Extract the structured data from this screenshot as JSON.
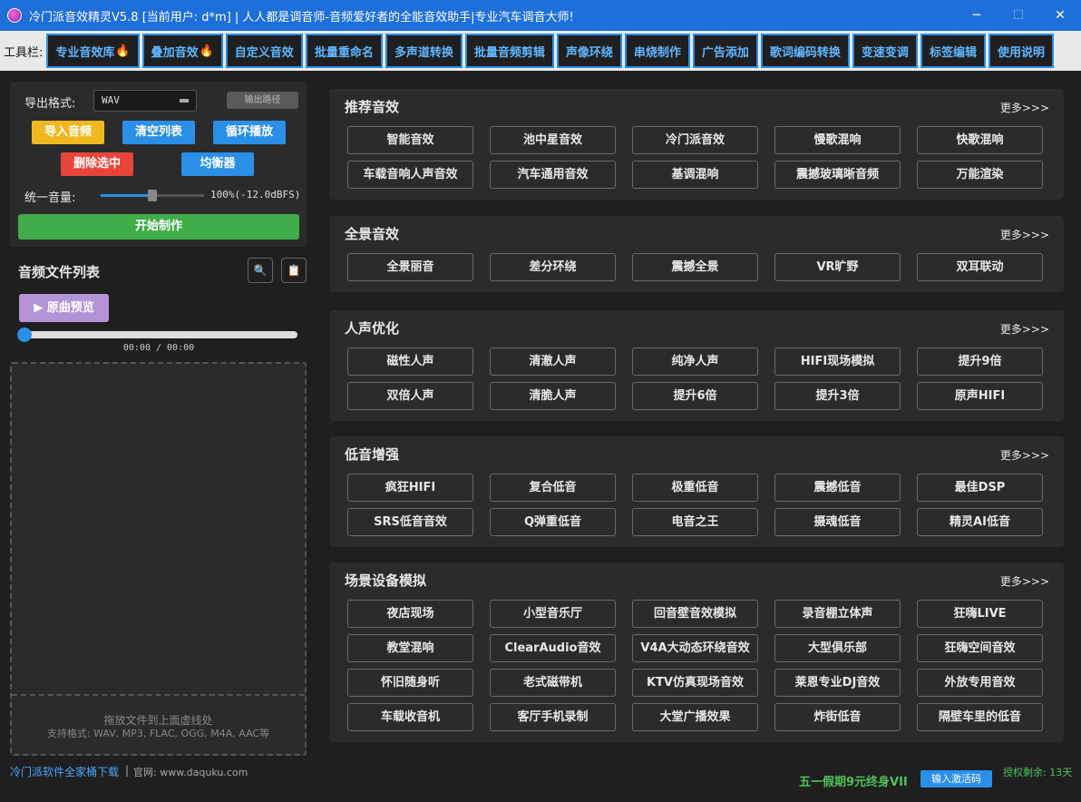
{
  "window": {
    "title": "冷门派音效精灵V5.8 [当前用户: d*m] | 人人都是调音师-音频爱好者的全能音效助手|专业汽车调音大师!",
    "minimize": "─",
    "maximize": "☐",
    "close": "✕"
  },
  "toolbar": {
    "label": "工具栏:",
    "items": [
      {
        "label": "专业音效库",
        "hot": true
      },
      {
        "label": "叠加音效",
        "hot": true
      },
      {
        "label": "自定义音效",
        "hot": false
      },
      {
        "label": "批量重命名",
        "hot": false
      },
      {
        "label": "多声道转换",
        "hot": false
      },
      {
        "label": "批量音频剪辑",
        "hot": false
      },
      {
        "label": "声像环绕",
        "hot": false
      },
      {
        "label": "串烧制作",
        "hot": false
      },
      {
        "label": "广告添加",
        "hot": false
      },
      {
        "label": "歌词编码转换",
        "hot": false
      },
      {
        "label": "变速变调",
        "hot": false
      },
      {
        "label": "标签编辑",
        "hot": false
      },
      {
        "label": "使用说明",
        "hot": false
      }
    ],
    "hot_glyph": "🔥"
  },
  "export": {
    "label": "导出格式:",
    "format": "WAV",
    "output_path": "输出路径",
    "import": "导入音频",
    "clear": "清空列表",
    "loop": "循环播放",
    "delete": "删除选中",
    "eq": "均衡器",
    "volume_label": "统一音量:",
    "volume_text": "100%(-12.0dBFS)",
    "volume_fraction": 0.5,
    "start": "开始制作"
  },
  "filelist": {
    "title": "音频文件列表",
    "search_glyph": "🔍",
    "clip_glyph": "📋",
    "preview": "▶ 原曲预览",
    "time": "00:00 / 00:00",
    "drop_hint": "拖放文件到上面虚线处",
    "formats": "支持格式: WAV, MP3, FLAC, OGG, M4A, AAC等"
  },
  "footer": {
    "link": "冷门派软件全家桶下载",
    "sep": "|",
    "site": "官网: www.daquku.com",
    "promo": "五一假期9元终身VII",
    "activate": "输入激活码",
    "license": "授权剩余: 13天"
  },
  "sections": [
    {
      "title": "推荐音效",
      "more": "更多>>>",
      "items": [
        "智能音效",
        "池中星音效",
        "冷门派音效",
        "慢歌混响",
        "快歌混响",
        "车载音响人声音效",
        "汽车通用音效",
        "基调混响",
        "震撼玻璃晰音频",
        "万能渲染"
      ]
    },
    {
      "title": "全景音效",
      "more": "更多>>>",
      "items": [
        "全景丽音",
        "差分环绕",
        "震撼全景",
        "VR旷野",
        "双耳联动"
      ]
    },
    {
      "title": "人声优化",
      "more": "更多>>>",
      "items": [
        "磁性人声",
        "清澈人声",
        "纯净人声",
        "HIFI现场模拟",
        "提升9倍",
        "双倍人声",
        "清脆人声",
        "提升6倍",
        "提升3倍",
        "原声HIFI"
      ]
    },
    {
      "title": "低音增强",
      "more": "更多>>>",
      "items": [
        "疯狂HIFI",
        "复合低音",
        "极重低音",
        "震撼低音",
        "最佳DSP",
        "SRS低音音效",
        "Q弹重低音",
        "电音之王",
        "摄魂低音",
        "精灵AI低音"
      ]
    },
    {
      "title": "场景设备模拟",
      "more": "更多>>>",
      "items": [
        "夜店现场",
        "小型音乐厅",
        "回音壁音效模拟",
        "录音棚立体声",
        "狂嗨LIVE",
        "教堂混响",
        "ClearAudio音效",
        "V4A大动态环绕音效",
        "大型俱乐部",
        "狂嗨空间音效",
        "怀旧随身听",
        "老式磁带机",
        "KTV仿真现场音效",
        "莱恩专业DJ音效",
        "外放专用音效",
        "车载收音机",
        "客厅手机录制",
        "大堂广播效果",
        "炸街低音",
        "隔壁车里的低音"
      ]
    }
  ]
}
